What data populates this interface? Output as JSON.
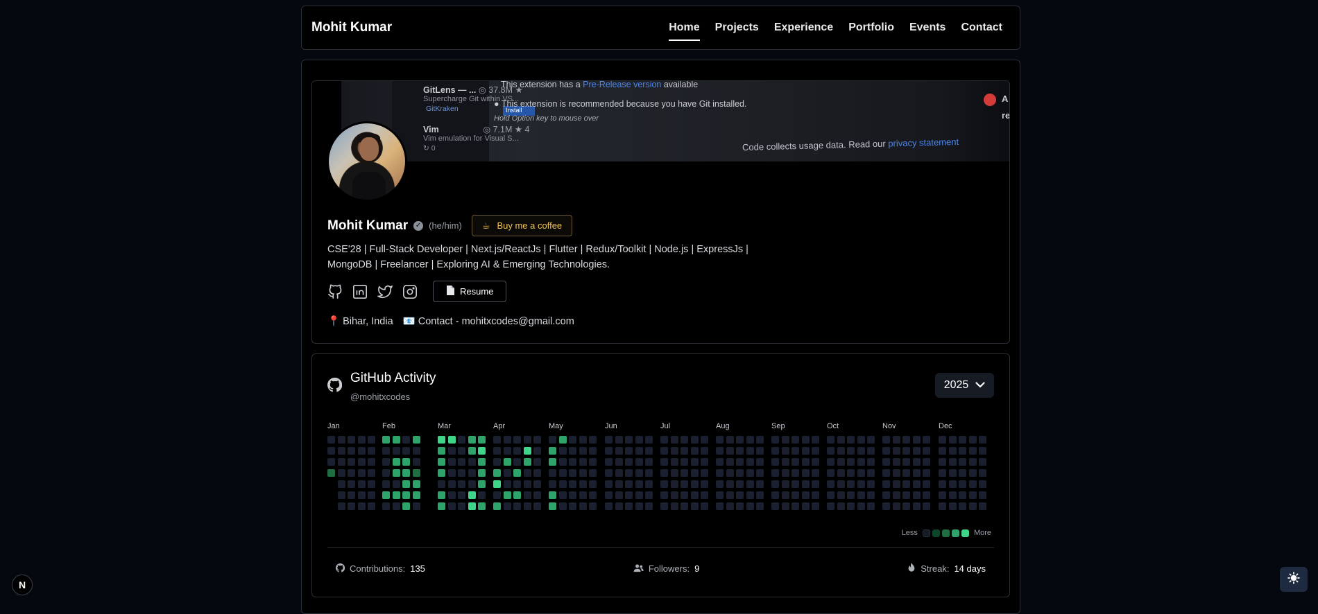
{
  "nav": {
    "brand": "Mohit Kumar",
    "links": [
      "Home",
      "Projects",
      "Experience",
      "Portfolio",
      "Events",
      "Contact"
    ],
    "active": "Home"
  },
  "banner": {
    "line1": "This extension has a ",
    "line1_link": "Pre-Release version",
    "line1_end": " available",
    "line2": "This extension is recommended because you have Git installed.",
    "line3": "Hold Option key to mouse over",
    "line4": "Code collects usage data. Read our ",
    "line4_link": "privacy statement",
    "ext1": "GitLens — ...",
    "ext1_count": "37.8M",
    "ext1_desc": "Supercharge Git within VS...",
    "ext1_pub": "GitKraken",
    "ext1_btn": "Install",
    "ext2": "Vim",
    "ext2_count": "7.1M",
    "ext2_desc": "Vim emulation for Visual S...",
    "right_a": "A",
    "right_re": "re"
  },
  "profile": {
    "name": "Mohit Kumar",
    "pronouns": "(he/him)",
    "coffee_label": "Buy me a coffee",
    "bio": "CSE'28 | Full-Stack Developer | Next.js/ReactJs | Flutter | Redux/Toolkit | Node.js | ExpressJs | MongoDB | Freelancer | Exploring AI & Emerging Technologies.",
    "resume_label": "Resume",
    "location": "📍 Bihar, India",
    "contact": "📧 Contact - mohitxcodes@gmail.com"
  },
  "github": {
    "title": "GitHub Activity",
    "username": "@mohitxcodes",
    "year": "2025",
    "months": [
      "Jan",
      "Feb",
      "Mar",
      "Apr",
      "May",
      "Jun",
      "Jul",
      "Aug",
      "Sep",
      "Oct",
      "Nov",
      "Dec"
    ],
    "legend_less": "Less",
    "legend_more": "More",
    "colors": [
      "#161b22",
      "#0e4429",
      "#1f6f43",
      "#2ea46a",
      "#3fd68a"
    ],
    "stats": {
      "contributions_label": "Contributions:",
      "contributions": "135",
      "followers_label": "Followers:",
      "followers": "9",
      "streak_label": "Streak:",
      "streak": "14 days"
    }
  },
  "corner": {
    "next_badge": "N"
  }
}
